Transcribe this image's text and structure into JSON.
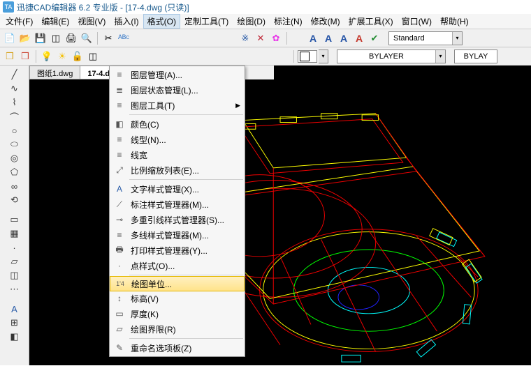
{
  "title": "迅捷CAD编辑器 6.2 专业版  - [17-4.dwg (只读)]",
  "menus": [
    "文件(F)",
    "编辑(E)",
    "视图(V)",
    "插入(I)",
    "格式(O)",
    "定制工具(T)",
    "绘图(D)",
    "标注(N)",
    "修改(M)",
    "扩展工具(X)",
    "窗口(W)",
    "帮助(H)"
  ],
  "active_menu": 4,
  "dropdowns": {
    "style_box": "Standard",
    "line_box1": "BYLAYER",
    "line_box2": "BYLAY"
  },
  "tabs": [
    "图纸1.dwg",
    "17-4.dwg (只读"
  ],
  "active_tab": 1,
  "menu_items": [
    {
      "icon": "≡",
      "label": "图层管理(A)..."
    },
    {
      "icon": "≣",
      "label": "图层状态管理(L)..."
    },
    {
      "icon": "≡",
      "label": "图层工具(T)",
      "arrow": true
    },
    {
      "sep": true
    },
    {
      "icon": "◧",
      "label": "颜色(C)"
    },
    {
      "icon": "≡",
      "label": "线型(N)..."
    },
    {
      "icon": "≡",
      "label": "线宽"
    },
    {
      "icon": "⤢",
      "label": "比例缩放列表(E)..."
    },
    {
      "sep": true
    },
    {
      "icon": "A",
      "label": "文字样式管理(X)..."
    },
    {
      "icon": "⟋",
      "label": "标注样式管理器(M)..."
    },
    {
      "icon": "⊸",
      "label": "多重引线样式管理器(S)..."
    },
    {
      "icon": "≡",
      "label": "多线样式管理器(M)..."
    },
    {
      "icon": "🖶",
      "label": "打印样式管理器(Y)..."
    },
    {
      "icon": "·",
      "label": "点样式(O)..."
    },
    {
      "sep": true
    },
    {
      "icon": "1'4",
      "label": "绘图单位...",
      "hl": true
    },
    {
      "icon": "↕",
      "label": "标高(V)"
    },
    {
      "icon": "▭",
      "label": "厚度(K)"
    },
    {
      "icon": "▱",
      "label": "绘图界限(R)"
    },
    {
      "sep": true
    },
    {
      "icon": "✎",
      "label": "重命名选项板(Z)"
    }
  ]
}
